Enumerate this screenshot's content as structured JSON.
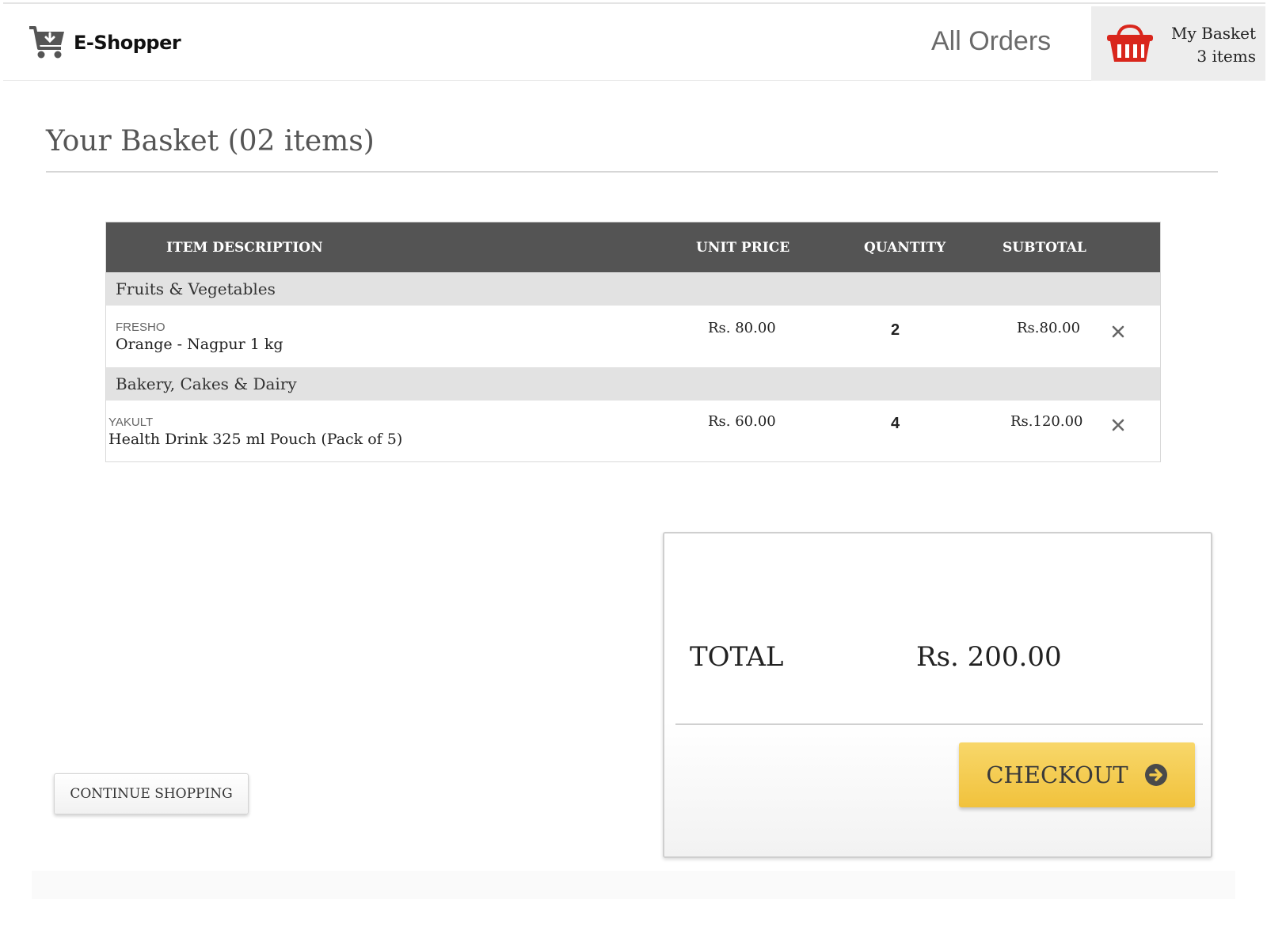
{
  "header": {
    "brand": "E-Shopper",
    "nav_orders": "All Orders",
    "basket_title": "My Basket",
    "basket_count": "3 items"
  },
  "page": {
    "title": "Your Basket (02 items)"
  },
  "table": {
    "headers": {
      "description": "ITEM DESCRIPTION",
      "unit_price": "UNIT PRICE",
      "quantity": "QUANTITY",
      "subtotal": "SUBTOTAL"
    },
    "groups": [
      {
        "category": "Fruits & Vegetables",
        "item": {
          "brand": "FRESHO",
          "name": "Orange - Nagpur 1 kg",
          "unit_price": "Rs. 80.00",
          "quantity": "2",
          "subtotal": "Rs.80.00"
        }
      },
      {
        "category": "Bakery, Cakes & Dairy",
        "item": {
          "brand": "YAKULT",
          "name": "Health Drink 325 ml Pouch (Pack of 5)",
          "unit_price": "Rs. 60.00",
          "quantity": "4",
          "subtotal": "Rs.120.00"
        }
      }
    ]
  },
  "summary": {
    "total_label": "TOTAL",
    "total_value": "Rs. 200.00",
    "checkout_label": "CHECKOUT"
  },
  "actions": {
    "continue_label": "CONTINUE SHOPPING"
  },
  "colors": {
    "accent_yellow": "#f1c23c",
    "basket_red": "#d9261c",
    "table_header": "#545454"
  },
  "icons": {
    "logo": "cart-download-icon",
    "basket": "basket-icon",
    "remove": "close-icon",
    "checkout": "arrow-circle-right-icon"
  }
}
